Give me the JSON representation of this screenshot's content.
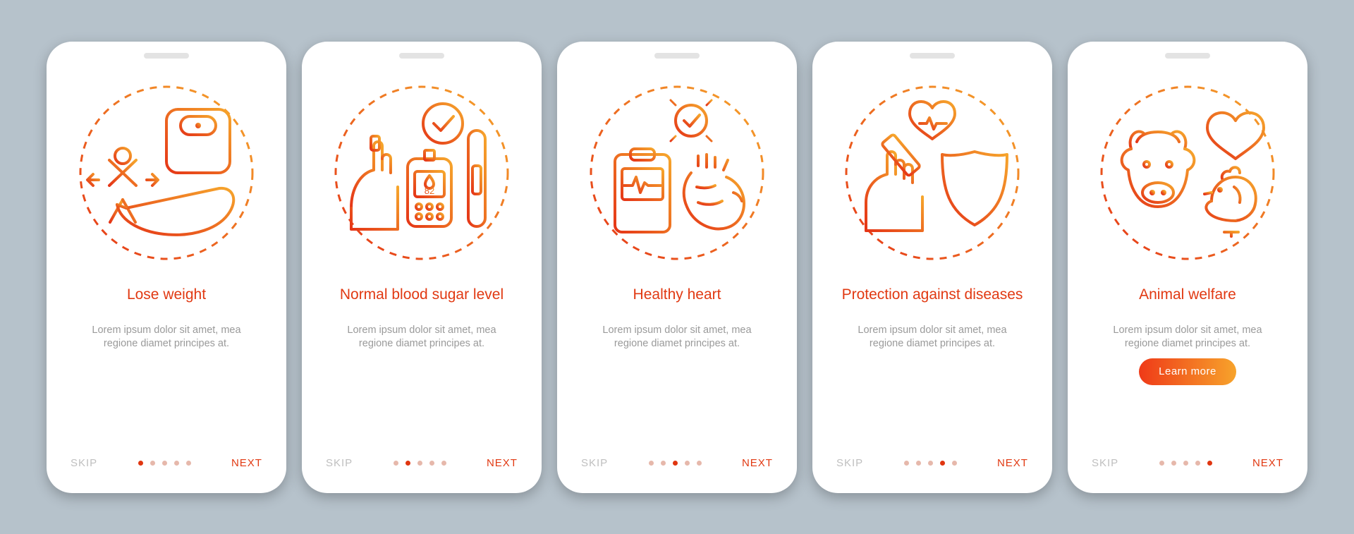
{
  "common": {
    "skip_label": "SKIP",
    "next_label": "NEXT",
    "body_text": "Lorem ipsum dolor sit amet, mea regione diamet principes at."
  },
  "screens": [
    {
      "title": "Lose weight",
      "icon_name": "lose-weight-icon",
      "active_dot": 0,
      "has_cta": false
    },
    {
      "title": "Normal blood sugar level",
      "icon_name": "blood-sugar-icon",
      "glucose_value": "82",
      "active_dot": 1,
      "has_cta": false
    },
    {
      "title": "Healthy heart",
      "icon_name": "healthy-heart-icon",
      "active_dot": 2,
      "has_cta": false
    },
    {
      "title": "Protection against diseases",
      "icon_name": "protection-diseases-icon",
      "active_dot": 3,
      "has_cta": false
    },
    {
      "title": "Animal welfare",
      "icon_name": "animal-welfare-icon",
      "active_dot": 4,
      "has_cta": true,
      "cta_label": "Learn more"
    }
  ],
  "colors": {
    "gradient_start": "#e53517",
    "gradient_end": "#f6a62c"
  }
}
